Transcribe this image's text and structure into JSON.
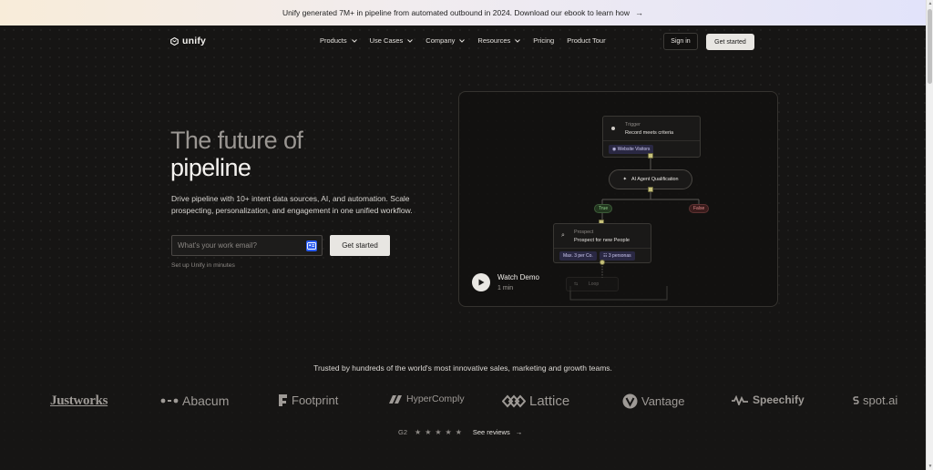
{
  "banner": {
    "text": "Unify generated 7M+ in pipeline from automated outbound in 2024. Download our ebook to learn how",
    "arrow": "→"
  },
  "nav": {
    "logo": "unify",
    "items": [
      {
        "label": "Products",
        "dropdown": true
      },
      {
        "label": "Use Cases",
        "dropdown": true
      },
      {
        "label": "Company",
        "dropdown": true
      },
      {
        "label": "Resources",
        "dropdown": true
      },
      {
        "label": "Pricing",
        "dropdown": false
      },
      {
        "label": "Product Tour",
        "dropdown": false
      }
    ],
    "signin": "Sign in",
    "cta": "Get started"
  },
  "hero": {
    "line1": "The future of",
    "line2": "pipeline",
    "subtitle": "Drive pipeline with 10+ intent data sources, AI, and automation. Scale prospecting, personalization, and engagement in one unified workflow.",
    "email_placeholder": "What's your work email?",
    "cta": "Get started",
    "note": "Set up Unify in minutes"
  },
  "workflow": {
    "trigger_label": "Trigger",
    "trigger_title": "Record meets criteria",
    "trigger_chip": "Website Visitors",
    "agent": "AI Agent Qualification",
    "true_label": "True",
    "false_label": "False",
    "prospect_label": "Prospect",
    "prospect_title": "Prospect for new People",
    "chip_max": "Max. 3 per Co.",
    "chip_persons": "3 personas",
    "loop_label": "Loop",
    "demo_title": "Watch Demo",
    "demo_duration": "1 min"
  },
  "trust": {
    "headline": "Trusted by hundreds of the world's most innovative sales, marketing and growth teams.",
    "logos": [
      "Justworks",
      "Abacum",
      "Footprint",
      "HyperComply",
      "Lattice",
      "Vantage",
      "Speechify",
      "spot.ai"
    ],
    "g2": "G2",
    "stars": "★★★★★",
    "reviews": "See reviews",
    "reviews_arrow": "→"
  },
  "colors": {
    "background": "#161514",
    "accent_light": "#e8e6e2",
    "banner_start": "#f8ecd9",
    "banner_end": "#e2e3fa",
    "true_green": "#8fd08a",
    "false_red": "#e08b8b"
  }
}
